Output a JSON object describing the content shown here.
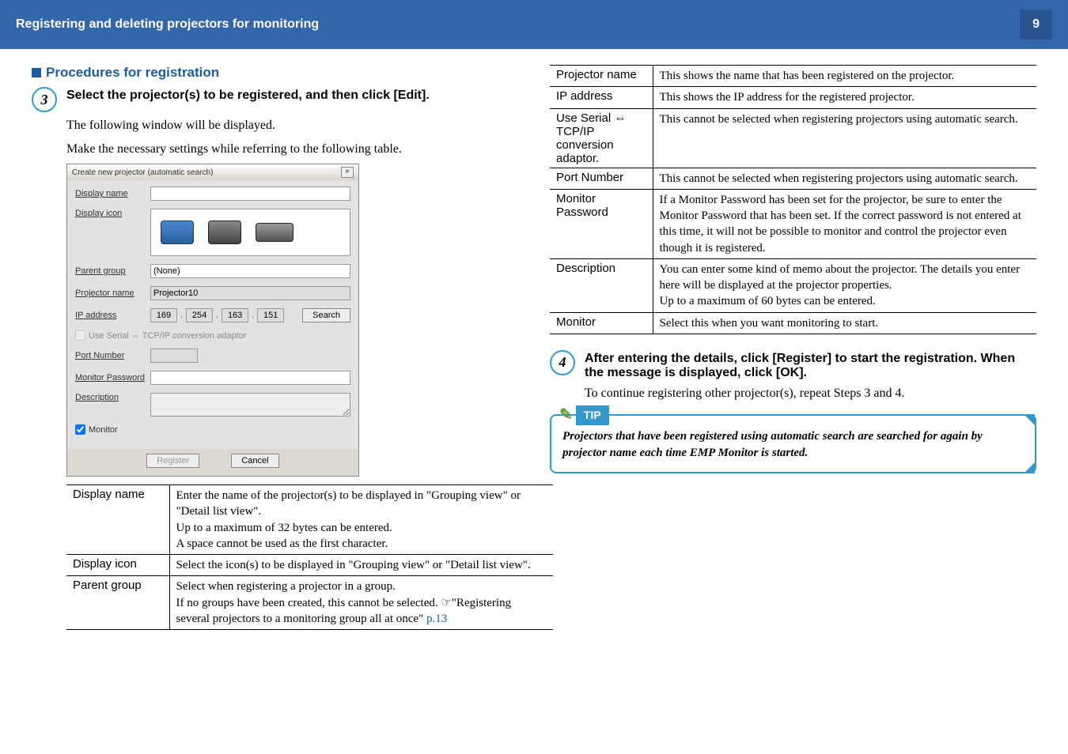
{
  "header": {
    "title": "Registering and deleting projectors for monitoring",
    "page": "9"
  },
  "section": {
    "title": "Procedures for registration"
  },
  "step3": {
    "num": "3",
    "title": "Select the projector(s) to be registered, and then click [Edit].",
    "line1": "The following window will be displayed.",
    "line2": "Make the necessary settings while referring to the following table."
  },
  "dialog": {
    "title": "Create new projector (automatic search)",
    "labels": {
      "display_name": "Display name",
      "display_icon": "Display icon",
      "parent_group": "Parent group",
      "projector_name": "Projector name",
      "ip_address": "IP address",
      "use_serial": "Use Serial ⇔ TCP/IP conversion adaptor",
      "port_number": "Port Number",
      "monitor_password": "Monitor Password",
      "description": "Description",
      "monitor": "Monitor"
    },
    "values": {
      "parent_group": "(None)",
      "projector_name": "Projector10",
      "ip": [
        "169",
        "254",
        "163",
        "151"
      ],
      "search": "Search",
      "register": "Register",
      "cancel": "Cancel"
    }
  },
  "table_left": [
    {
      "k": "Display name",
      "v": "Enter the name of the projector(s) to be displayed in \"Grouping view\" or \"Detail list view\".\nUp to a maximum of 32 bytes can be entered.\nA space cannot be used as the first character."
    },
    {
      "k": "Display icon",
      "v": "Select the icon(s) to be displayed in \"Grouping view\" or \"Detail list view\"."
    },
    {
      "k": "Parent group",
      "v": "Select when registering a projector in a group.\nIf no groups have been created, this cannot be selected. ☞\"Registering several projectors to a monitoring group all at once\" ",
      "link": "p.13"
    }
  ],
  "table_right": [
    {
      "k": "Projector name",
      "v": "This shows the name that has been registered on the projector."
    },
    {
      "k": "IP address",
      "v": "This shows the IP address for the registered projector."
    },
    {
      "k": "Use Serial ⇔ TCP/IP conversion adaptor.",
      "v": "This cannot be selected when registering projectors using automatic search."
    },
    {
      "k": "Port Number",
      "v": "This cannot be selected when registering projectors using automatic search."
    },
    {
      "k": "Monitor Password",
      "v": "If a Monitor Password has been set for the projector, be sure to enter the Monitor Password that has been set. If the correct password is not entered at this time, it will not be possible to monitor and control the projector even though it is registered."
    },
    {
      "k": "Description",
      "v": "You can enter some kind of memo about the projector. The details you enter here will be displayed at the projector properties.\nUp to a maximum of 60 bytes can be entered."
    },
    {
      "k": "Monitor",
      "v": "Select this when you want monitoring to start."
    }
  ],
  "step4": {
    "num": "4",
    "title": "After entering the details, click [Register] to start the registration. When the message is displayed, click [OK].",
    "line1": "To continue registering other projector(s), repeat Steps 3 and 4."
  },
  "tip": {
    "label": "TIP",
    "text": "Projectors that have been registered using automatic search are searched for again by projector name each time EMP Monitor is started."
  }
}
